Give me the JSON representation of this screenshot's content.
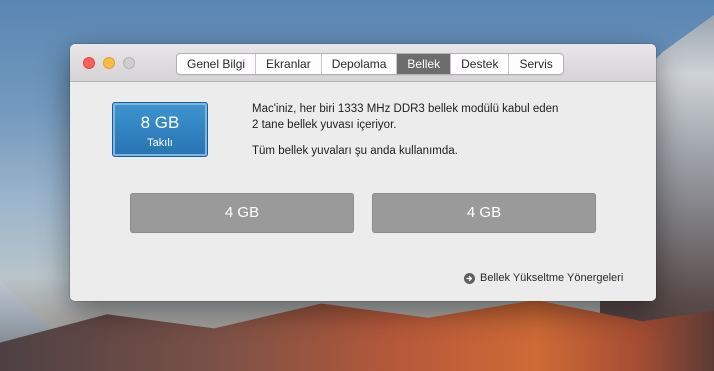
{
  "tabs": [
    {
      "label": "Genel Bilgi",
      "active": false
    },
    {
      "label": "Ekranlar",
      "active": false
    },
    {
      "label": "Depolama",
      "active": false
    },
    {
      "label": "Bellek",
      "active": true
    },
    {
      "label": "Destek",
      "active": false
    },
    {
      "label": "Servis",
      "active": false
    }
  ],
  "memory": {
    "size": "8 GB",
    "status": "Takılı"
  },
  "description": {
    "line1": "Mac'iniz, her biri 1333 MHz DDR3 bellek modülü kabul eden",
    "line2": "2 tane bellek yuvası içeriyor.",
    "status": "Tüm bellek yuvaları şu anda kullanımda."
  },
  "slots": [
    {
      "label": "4 GB"
    },
    {
      "label": "4 GB"
    }
  ],
  "upgrade_link": {
    "label": "Bellek Yükseltme Yönergeleri",
    "icon": "arrow-circle-right-icon"
  },
  "colors": {
    "accent_active_tab": "#6d6d6d",
    "memory_card": "#2f80c0",
    "slot_fill": "#9a9a9a",
    "close": "#fc605b",
    "minimize": "#fdbc40",
    "zoom": "#cfcdcf"
  }
}
